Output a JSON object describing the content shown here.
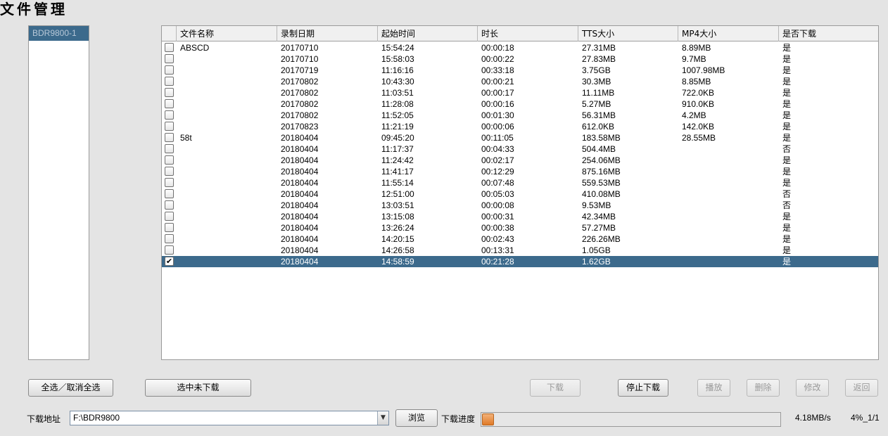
{
  "window": {
    "title": "文件管理"
  },
  "devices": [
    "BDR9800-1"
  ],
  "table": {
    "columns": [
      "文件名称",
      "录制日期",
      "起始时间",
      "时长",
      "TTS大小",
      "MP4大小",
      "是否下载"
    ],
    "rows": [
      {
        "checked": false,
        "name": "ABSCD",
        "date": "20170710",
        "start": "15:54:24",
        "duration": "00:00:18",
        "tts": "27.31MB",
        "mp4": "8.89MB",
        "downloaded": "是"
      },
      {
        "checked": false,
        "name": "",
        "date": "20170710",
        "start": "15:58:03",
        "duration": "00:00:22",
        "tts": "27.83MB",
        "mp4": "9.7MB",
        "downloaded": "是"
      },
      {
        "checked": false,
        "name": "",
        "date": "20170719",
        "start": "11:16:16",
        "duration": "00:33:18",
        "tts": "3.75GB",
        "mp4": "1007.98MB",
        "downloaded": "是"
      },
      {
        "checked": false,
        "name": "",
        "date": "20170802",
        "start": "10:43:30",
        "duration": "00:00:21",
        "tts": "30.3MB",
        "mp4": "8.85MB",
        "downloaded": "是"
      },
      {
        "checked": false,
        "name": "",
        "date": "20170802",
        "start": "11:03:51",
        "duration": "00:00:17",
        "tts": "11.11MB",
        "mp4": "722.0KB",
        "downloaded": "是"
      },
      {
        "checked": false,
        "name": "",
        "date": "20170802",
        "start": "11:28:08",
        "duration": "00:00:16",
        "tts": "5.27MB",
        "mp4": "910.0KB",
        "downloaded": "是"
      },
      {
        "checked": false,
        "name": "",
        "date": "20170802",
        "start": "11:52:05",
        "duration": "00:01:30",
        "tts": "56.31MB",
        "mp4": "4.2MB",
        "downloaded": "是"
      },
      {
        "checked": false,
        "name": "",
        "date": "20170823",
        "start": "11:21:19",
        "duration": "00:00:06",
        "tts": "612.0KB",
        "mp4": "142.0KB",
        "downloaded": "是"
      },
      {
        "checked": false,
        "name": "58t",
        "date": "20180404",
        "start": "09:45:20",
        "duration": "00:11:05",
        "tts": "183.58MB",
        "mp4": "28.55MB",
        "downloaded": "是"
      },
      {
        "checked": false,
        "name": "",
        "date": "20180404",
        "start": "11:17:37",
        "duration": "00:04:33",
        "tts": "504.4MB",
        "mp4": "",
        "downloaded": "否"
      },
      {
        "checked": false,
        "name": "",
        "date": "20180404",
        "start": "11:24:42",
        "duration": "00:02:17",
        "tts": "254.06MB",
        "mp4": "",
        "downloaded": "是"
      },
      {
        "checked": false,
        "name": "",
        "date": "20180404",
        "start": "11:41:17",
        "duration": "00:12:29",
        "tts": "875.16MB",
        "mp4": "",
        "downloaded": "是"
      },
      {
        "checked": false,
        "name": "",
        "date": "20180404",
        "start": "11:55:14",
        "duration": "00:07:48",
        "tts": "559.53MB",
        "mp4": "",
        "downloaded": "是"
      },
      {
        "checked": false,
        "name": "",
        "date": "20180404",
        "start": "12:51:00",
        "duration": "00:05:03",
        "tts": "410.08MB",
        "mp4": "",
        "downloaded": "否"
      },
      {
        "checked": false,
        "name": "",
        "date": "20180404",
        "start": "13:03:51",
        "duration": "00:00:08",
        "tts": "9.53MB",
        "mp4": "",
        "downloaded": "否"
      },
      {
        "checked": false,
        "name": "",
        "date": "20180404",
        "start": "13:15:08",
        "duration": "00:00:31",
        "tts": "42.34MB",
        "mp4": "",
        "downloaded": "是"
      },
      {
        "checked": false,
        "name": "",
        "date": "20180404",
        "start": "13:26:24",
        "duration": "00:00:38",
        "tts": "57.27MB",
        "mp4": "",
        "downloaded": "是"
      },
      {
        "checked": false,
        "name": "",
        "date": "20180404",
        "start": "14:20:15",
        "duration": "00:02:43",
        "tts": "226.26MB",
        "mp4": "",
        "downloaded": "是"
      },
      {
        "checked": false,
        "name": "",
        "date": "20180404",
        "start": "14:26:58",
        "duration": "00:13:31",
        "tts": "1.05GB",
        "mp4": "",
        "downloaded": "是"
      },
      {
        "checked": true,
        "selected": true,
        "name": "",
        "date": "20180404",
        "start": "14:58:59",
        "duration": "00:21:28",
        "tts": "1.62GB",
        "mp4": "",
        "downloaded": "是"
      }
    ]
  },
  "buttons": {
    "select_all": "全选／取消全选",
    "select_not_downloaded": "选中未下载",
    "download": "下载",
    "stop_download": "停止下载",
    "play": "播放",
    "delete": "删除",
    "modify": "修改",
    "back": "返回",
    "browse": "浏览"
  },
  "download": {
    "path_label": "下载地址",
    "path_value": "F:\\BDR9800",
    "progress_label": "下载进度",
    "progress_fraction": 0.04,
    "speed": "4.18MB/s",
    "status": "4%_1/1"
  },
  "colors": {
    "selection": "#3c6a8c",
    "progress": "#e07a28"
  },
  "icons": {
    "checkbox_checked": "✔",
    "dropdown": "▼"
  }
}
